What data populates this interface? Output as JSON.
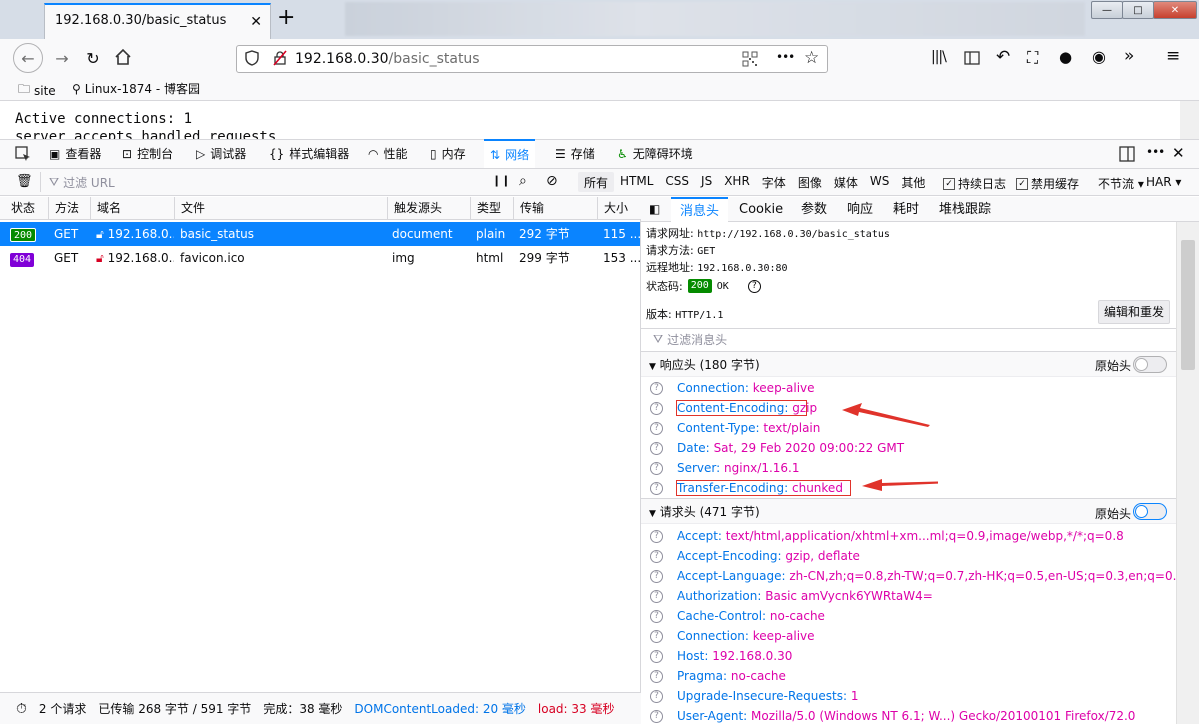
{
  "tab": {
    "title": "192.168.0.30/basic_status",
    "close": "✕",
    "new": "+"
  },
  "window": {
    "min": "—",
    "max": "□",
    "close": "✕"
  },
  "address": {
    "host": "192.168.0.30",
    "path": "/basic_status",
    "more": "•••"
  },
  "bookmarks": [
    {
      "label": "site"
    },
    {
      "label": "Linux-1874 - 博客园"
    }
  ],
  "page": {
    "line1": "Active connections: 1",
    "line2": "server accepts handled requests"
  },
  "devtools": {
    "tools": [
      {
        "label": "查看器"
      },
      {
        "label": "控制台"
      },
      {
        "label": "调试器"
      },
      {
        "label": "样式编辑器"
      },
      {
        "label": "性能"
      },
      {
        "label": "内存"
      },
      {
        "label": "网络"
      },
      {
        "label": "存储"
      },
      {
        "label": "无障碍环境"
      }
    ],
    "filter": {
      "placeholder": "过滤 URL",
      "types": [
        "所有",
        "HTML",
        "CSS",
        "JS",
        "XHR",
        "字体",
        "图像",
        "媒体",
        "WS",
        "其他"
      ],
      "persist": "持续日志",
      "disable_cache": "禁用缓存",
      "throttle": "不节流 ▾",
      "har": "HAR ▾"
    },
    "columns": [
      "状态",
      "方法",
      "域名",
      "文件",
      "触发源头",
      "类型",
      "传输",
      "大小"
    ],
    "rows": [
      {
        "status": "200",
        "method": "GET",
        "domain": "192.168.0....",
        "file": "basic_status",
        "cause": "document",
        "type": "plain",
        "transferred": "292 字节",
        "size": "115 ..."
      },
      {
        "status": "404",
        "method": "GET",
        "domain": "192.168.0....",
        "file": "favicon.ico",
        "cause": "img",
        "type": "html",
        "transferred": "299 字节",
        "size": "153 ..."
      }
    ],
    "statusbar": {
      "requests": "2 个请求",
      "transferred": "已传输 268 字节 / 591 字节",
      "finish": "完成：38 毫秒",
      "dcl": "DOMContentLoaded: 20 毫秒",
      "load": "load: 33 毫秒"
    },
    "detail_tabs": [
      "消息头",
      "Cookie",
      "参数",
      "响应",
      "耗时",
      "堆栈跟踪"
    ],
    "summary": {
      "url_label": "请求网址:",
      "url": "http://192.168.0.30/basic_status",
      "method_label": "请求方法:",
      "method": "GET",
      "remote_label": "远程地址:",
      "remote": "192.168.0.30:80",
      "status_label": "状态码:",
      "status_code": "200",
      "status_text": "OK",
      "version_label": "版本:",
      "version": "HTTP/1.1",
      "edit_resend": "编辑和重发",
      "filter_headers": "过滤消息头"
    },
    "response_headers": {
      "title": "响应头 (180 字节)",
      "raw": "原始头",
      "items": [
        {
          "name": "Connection:",
          "value": "keep-alive"
        },
        {
          "name": "Content-Encoding:",
          "value": "gzip"
        },
        {
          "name": "Content-Type:",
          "value": "text/plain"
        },
        {
          "name": "Date:",
          "value": "Sat, 29 Feb 2020 09:00:22 GMT"
        },
        {
          "name": "Server:",
          "value": "nginx/1.16.1"
        },
        {
          "name": "Transfer-Encoding:",
          "value": "chunked"
        }
      ]
    },
    "request_headers": {
      "title": "请求头 (471 字节)",
      "raw": "原始头",
      "items": [
        {
          "name": "Accept:",
          "value": "text/html,application/xhtml+xm...ml;q=0.9,image/webp,*/*;q=0.8"
        },
        {
          "name": "Accept-Encoding:",
          "value": "gzip, deflate"
        },
        {
          "name": "Accept-Language:",
          "value": "zh-CN,zh;q=0.8,zh-TW;q=0.7,zh-HK;q=0.5,en-US;q=0.3,en;q=0.2"
        },
        {
          "name": "Authorization:",
          "value": "Basic amVycnk6YWRtaW4="
        },
        {
          "name": "Cache-Control:",
          "value": "no-cache"
        },
        {
          "name": "Connection:",
          "value": "keep-alive"
        },
        {
          "name": "Host:",
          "value": "192.168.0.30"
        },
        {
          "name": "Pragma:",
          "value": "no-cache"
        },
        {
          "name": "Upgrade-Insecure-Requests:",
          "value": "1"
        },
        {
          "name": "User-Agent:",
          "value": "Mozilla/5.0 (Windows NT 6.1; W...) Gecko/20100101 Firefox/72.0"
        }
      ]
    }
  },
  "colors": {
    "accent": "#0a84ff",
    "selected_row": "#0a84ff",
    "status_ok": "#058b00",
    "status_404": "#8000d7",
    "header_name": "#0074e8",
    "header_value": "#dd00a9",
    "annotation": "#e0332b"
  }
}
